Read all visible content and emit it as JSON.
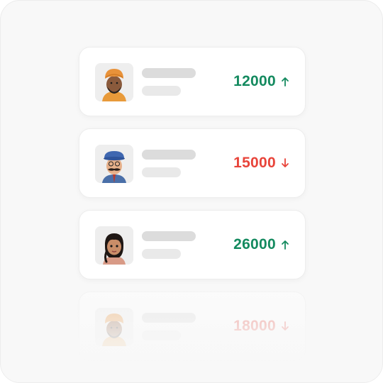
{
  "colors": {
    "up": "#148a5f",
    "down": "#e8443a",
    "panel_bg": "#f8f8f8",
    "card_bg": "#ffffff",
    "placeholder": "#dcdcdc"
  },
  "rows": [
    {
      "avatar": "man-with-orange-turban-avatar",
      "amount": "12000",
      "trend": "up",
      "trend_icon": "arrow-up-icon"
    },
    {
      "avatar": "man-with-blue-cap-and-mustache-avatar",
      "amount": "15000",
      "trend": "down",
      "trend_icon": "arrow-down-icon"
    },
    {
      "avatar": "woman-with-braid-avatar",
      "amount": "26000",
      "trend": "up",
      "trend_icon": "arrow-up-icon"
    },
    {
      "avatar": "man-with-orange-turban-avatar",
      "amount": "18000",
      "trend": "down",
      "trend_icon": "arrow-down-icon"
    }
  ]
}
